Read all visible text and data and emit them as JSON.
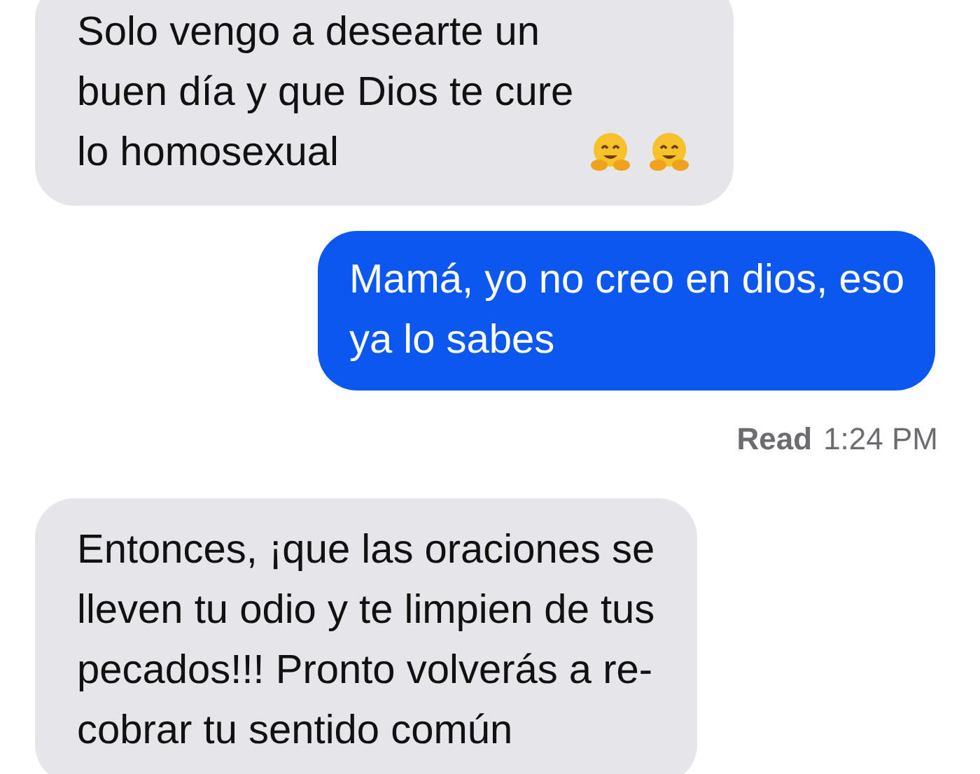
{
  "messages": [
    {
      "kind": "received",
      "text": "Solo vengo a desearte un\nbuen día y que Dios te cure\nlo homosexual",
      "emojis": [
        {
          "kind": "hug"
        },
        {
          "kind": "hug"
        }
      ]
    },
    {
      "kind": "sent",
      "text": "Mamá, yo no creo en dios, eso\nya lo sabes"
    },
    {
      "kind": "receipt",
      "label": "Read",
      "time": "1:24 PM"
    },
    {
      "kind": "received",
      "text": "Entonces, ¡que las oraciones se\nlleven tu odio y te limpien de tus\npecados!!! Pronto volverás a re-\ncobrar tu sentido común"
    }
  ]
}
